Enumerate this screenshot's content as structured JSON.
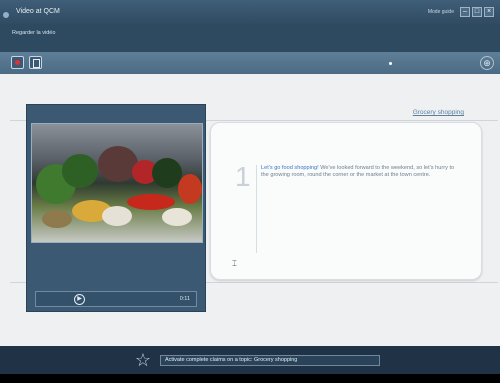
{
  "window": {
    "title": "Video at QCM",
    "mode_label": "Mode guide"
  },
  "subbar": {
    "breadcrumb": "Regarder la vidéo"
  },
  "toolbar": {
    "right_icon": "⊕"
  },
  "content": {
    "topic_link": "Grocery shopping",
    "step": {
      "number": "1",
      "lead": "Let's go food shopping!",
      "body": " We've looked forward to the weekend, so let's hurry to the growing room, round the corner or the market at the town centre."
    }
  },
  "video": {
    "time": "0:11"
  },
  "status": {
    "text": "Activate complete claims on a topic: Grocery shopping"
  },
  "colors": {
    "titlebar": "#3f5e78",
    "panel": "#3b5973",
    "accent_link": "#3b78c4"
  },
  "icons": [
    "record-icon",
    "document-icon",
    "add-icon",
    "play-icon",
    "star-icon",
    "cursor-icon"
  ]
}
